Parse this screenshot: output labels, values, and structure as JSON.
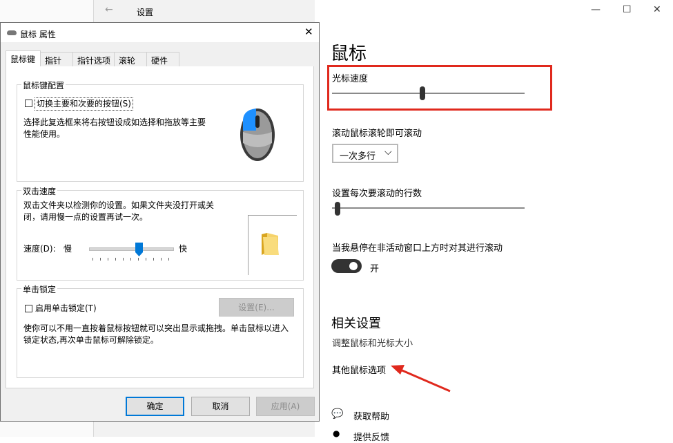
{
  "settings": {
    "title": "设置",
    "back": "←",
    "page_title": "鼠标",
    "cursor_speed": {
      "label": "光标速度",
      "value": 0.47
    },
    "scroll_wheel": {
      "label": "滚动鼠标滚轮即可滚动",
      "selected": "一次多行"
    },
    "lines_per_scroll": {
      "label": "设置每次要滚动的行数",
      "value": 0.03
    },
    "inactive_scroll": {
      "label": "当我悬停在非活动窗口上方时对其进行滚动",
      "state": "开"
    },
    "related_title": "相关设置",
    "links": [
      "调整鼠标和光标大小",
      "其他鼠标选项"
    ],
    "help": [
      "获取帮助",
      "提供反馈"
    ],
    "window_buttons": {
      "minimize": "—",
      "maximize": "☐",
      "close": "✕"
    }
  },
  "dialog": {
    "title": "鼠标 属性",
    "close": "✕",
    "tabs": [
      "鼠标键",
      "指针",
      "指针选项",
      "滚轮",
      "硬件"
    ],
    "button_config": {
      "group": "鼠标键配置",
      "checkbox": "切换主要和次要的按钮(S)",
      "desc": "选择此复选框来将右按钮设成如选择和拖放等主要性能使用。"
    },
    "double_click": {
      "group": "双击速度",
      "desc": "双击文件夹以检测你的设置。如果文件夹没打开或关闭，请用慢一点的设置再试一次。",
      "speed_label": "速度(D):",
      "slow": "慢",
      "fast": "快",
      "value": 0.6
    },
    "click_lock": {
      "group": "单击锁定",
      "checkbox": "启用单击锁定(T)",
      "settings_btn": "设置(E)...",
      "desc": "使你可以不用一直按着鼠标按钮就可以突出显示或拖拽。单击鼠标以进入锁定状态,再次单击鼠标可解除锁定。"
    },
    "buttons": {
      "ok": "确定",
      "cancel": "取消",
      "apply": "应用(A)"
    }
  },
  "colors": {
    "accent": "#0078d7",
    "highlight": "#e0291d"
  }
}
